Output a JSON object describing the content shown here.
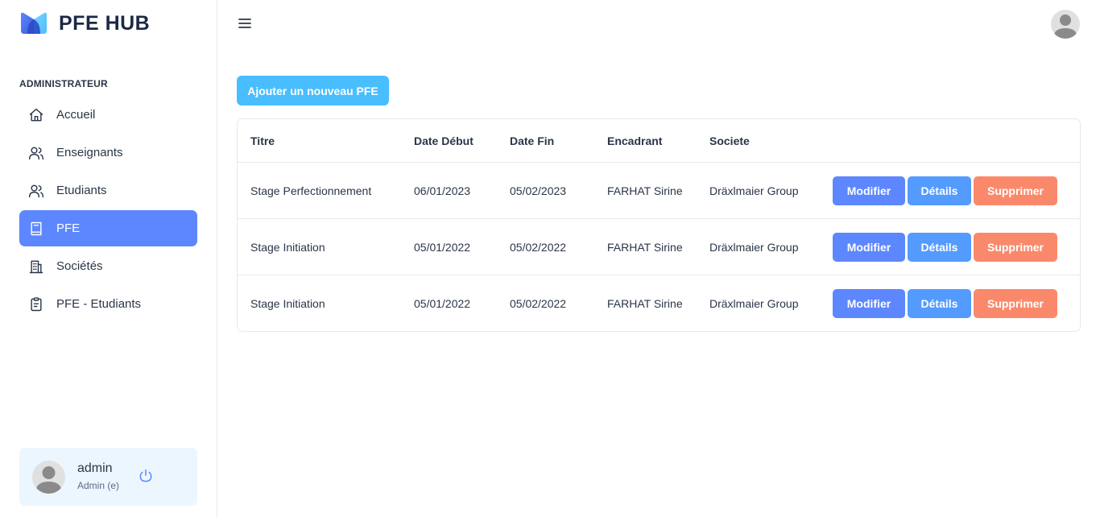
{
  "brand": {
    "name": "PFE HUB"
  },
  "sidebar": {
    "section_label": "ADMINISTRATEUR",
    "items": [
      {
        "label": "Accueil",
        "icon": "home-icon",
        "active": false
      },
      {
        "label": "Enseignants",
        "icon": "users-icon",
        "active": false
      },
      {
        "label": "Etudiants",
        "icon": "users-icon",
        "active": false
      },
      {
        "label": "PFE",
        "icon": "book-icon",
        "active": true
      },
      {
        "label": "Sociétés",
        "icon": "building-icon",
        "active": false
      },
      {
        "label": "PFE - Etudiants",
        "icon": "clipboard-icon",
        "active": false
      }
    ],
    "user": {
      "name": "admin",
      "role": "Admin (e)"
    }
  },
  "main": {
    "add_button": "Ajouter un nouveau PFE",
    "table": {
      "headers": [
        "Titre",
        "Date Début",
        "Date Fin",
        "Encadrant",
        "Societe"
      ],
      "rows": [
        [
          "Stage Perfectionnement",
          "06/01/2023",
          "05/02/2023",
          "FARHAT Sirine",
          "Dräxlmaier Group"
        ],
        [
          "Stage Initiation",
          "05/01/2022",
          "05/02/2022",
          "FARHAT Sirine",
          "Dräxlmaier Group"
        ],
        [
          "Stage Initiation",
          "05/01/2022",
          "05/02/2022",
          "FARHAT Sirine",
          "Dräxlmaier Group"
        ]
      ],
      "actions": {
        "edit": "Modifier",
        "details": "Détails",
        "delete": "Supprimer"
      }
    }
  },
  "colors": {
    "primary": "#5d87ff",
    "info": "#539bff",
    "secondary": "#49beff",
    "danger": "#fa896b",
    "text": "#2a3547"
  }
}
